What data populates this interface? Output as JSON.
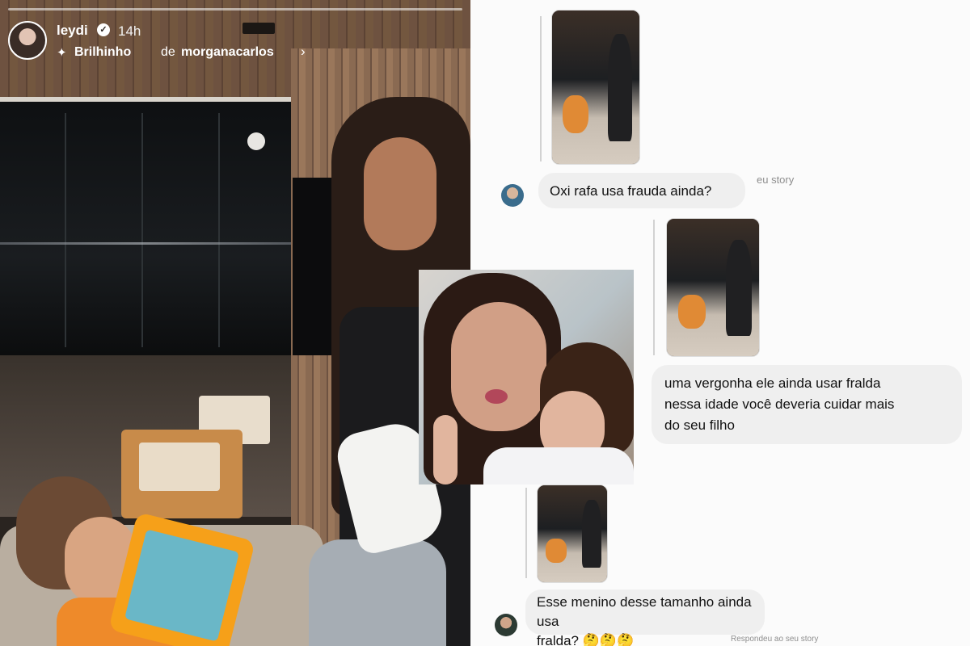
{
  "story": {
    "username": "leydi",
    "verified_icon": "verified-badge-icon",
    "time": "14h",
    "sub_label": "Brilhinho",
    "sub_of": "de",
    "sub_user": "morganacarlos"
  },
  "dm": {
    "messages": [
      {
        "text": "Oxi rafa usa frauda ainda?"
      },
      {
        "lines": [
          "uma vergonha ele ainda usar fralda",
          "nessa idade você deveria cuidar mais",
          "do seu filho"
        ]
      },
      {
        "lines": [
          "Esse menino desse tamanho ainda usa",
          "fralda? 🤔🤔🤔"
        ]
      }
    ],
    "reply_note_partial": "eu story",
    "reply_note": "Respondeu ao seu story"
  }
}
